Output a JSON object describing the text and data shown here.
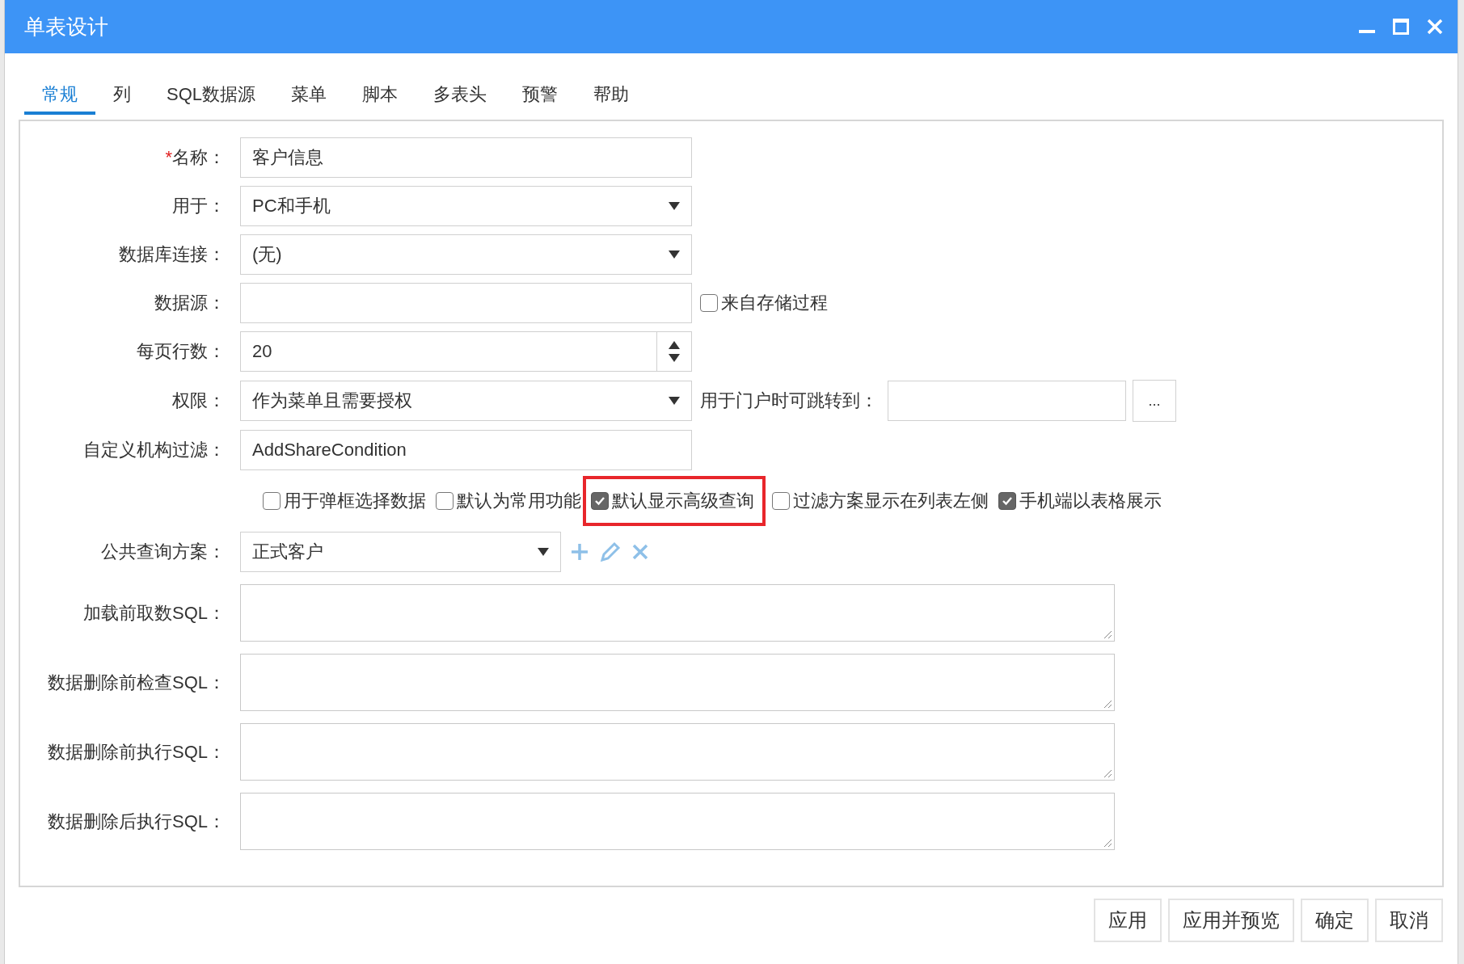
{
  "window": {
    "title": "单表设计"
  },
  "tabs": [
    {
      "label": "常规",
      "selected": true
    },
    {
      "label": "列",
      "selected": false
    },
    {
      "label": "SQL数据源",
      "selected": false
    },
    {
      "label": "菜单",
      "selected": false
    },
    {
      "label": "脚本",
      "selected": false
    },
    {
      "label": "多表头",
      "selected": false
    },
    {
      "label": "预警",
      "selected": false
    },
    {
      "label": "帮助",
      "selected": false
    }
  ],
  "fields": [
    {
      "kind": "text",
      "required_mark": "*",
      "label": "名称：",
      "value": "客户信息"
    },
    {
      "kind": "select",
      "label": "用于：",
      "value": "PC和手机"
    },
    {
      "kind": "select",
      "label": "数据库连接：",
      "value": "(无)"
    },
    {
      "kind": "text",
      "label": "数据源：",
      "checkbox": {
        "label": "来自存储过程",
        "checked": false
      }
    },
    {
      "kind": "spinner",
      "label": "每页行数：",
      "value": "20"
    },
    {
      "kind": "select",
      "label": "权限：",
      "value": "作为菜单且需要授权",
      "link_field": {
        "label": "用于门户时可跳转到：",
        "button": "..."
      }
    },
    {
      "kind": "text",
      "label": "自定义机构过滤：",
      "value": "AddShareCondition"
    },
    {
      "kind": "options",
      "options": [
        {
          "label": "用于弹框选择数据",
          "checked": false,
          "highlighted": false
        },
        {
          "label": "默认为常用功能",
          "checked": false,
          "highlighted": false
        },
        {
          "label": "默认显示高级查询",
          "checked": true,
          "highlighted": true
        },
        {
          "label": "过滤方案显示在列表左侧",
          "checked": false,
          "highlighted": false
        },
        {
          "label": "手机端以表格展示",
          "checked": true,
          "highlighted": false
        }
      ]
    },
    {
      "kind": "scheme",
      "label": "公共查询方案：",
      "value": "正式客户"
    },
    {
      "kind": "textarea",
      "label": "加载前取数SQL："
    },
    {
      "kind": "textarea",
      "label": "数据删除前检查SQL："
    },
    {
      "kind": "textarea",
      "label": "数据删除前执行SQL："
    },
    {
      "kind": "textarea",
      "label": "数据删除后执行SQL："
    }
  ],
  "buttons": [
    "应用",
    "应用并预览",
    "确定",
    "取消"
  ]
}
